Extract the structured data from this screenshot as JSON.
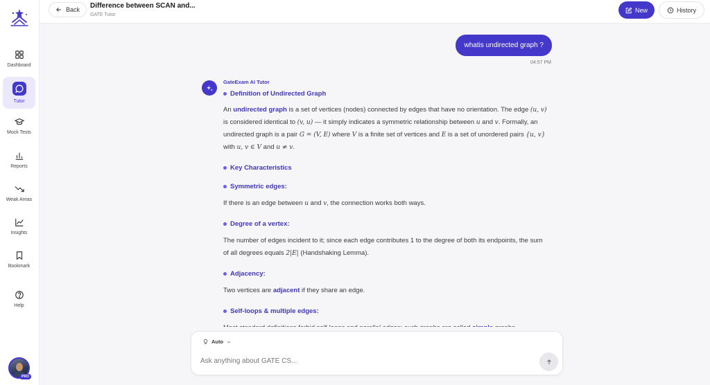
{
  "sidebar": {
    "items": [
      {
        "label": "Dashboard",
        "icon": "dashboard-icon"
      },
      {
        "label": "Tutor",
        "icon": "chat-bubble-icon",
        "active": true
      },
      {
        "label": "Mock Tests",
        "icon": "graduation-cap-icon"
      },
      {
        "label": "Reports",
        "icon": "bar-chart-icon"
      },
      {
        "label": "Weak Areas",
        "icon": "trending-down-icon"
      },
      {
        "label": "Insights",
        "icon": "line-chart-icon"
      },
      {
        "label": "Bookmark",
        "icon": "bookmark-icon"
      },
      {
        "label": "Help",
        "icon": "help-circle-icon"
      }
    ],
    "badge": "PRO"
  },
  "header": {
    "back_label": "Back",
    "title": "Difference between SCAN and...",
    "subtitle": "GATE Tutor",
    "new_label": "New",
    "history_label": "History"
  },
  "chat": {
    "user_message": "whatis undirected graph ?",
    "user_time": "04:57 PM",
    "ai_name": "GateExam AI Tutor",
    "h_definition": "Definition of Undirected Graph",
    "h_key": "Key Characteristics",
    "h_symmetric": "Symmetric edges:",
    "h_degree": "Degree of a vertex:",
    "h_adjacency": "Adjacency:",
    "h_selfloops": "Self-loops & multiple edges:"
  },
  "composer": {
    "mode": "Auto",
    "placeholder": "Ask anything about GATE CS..."
  },
  "colors": {
    "accent": "#4338ca",
    "accent_light": "#ebe8fb",
    "background": "#f6f6f8"
  }
}
